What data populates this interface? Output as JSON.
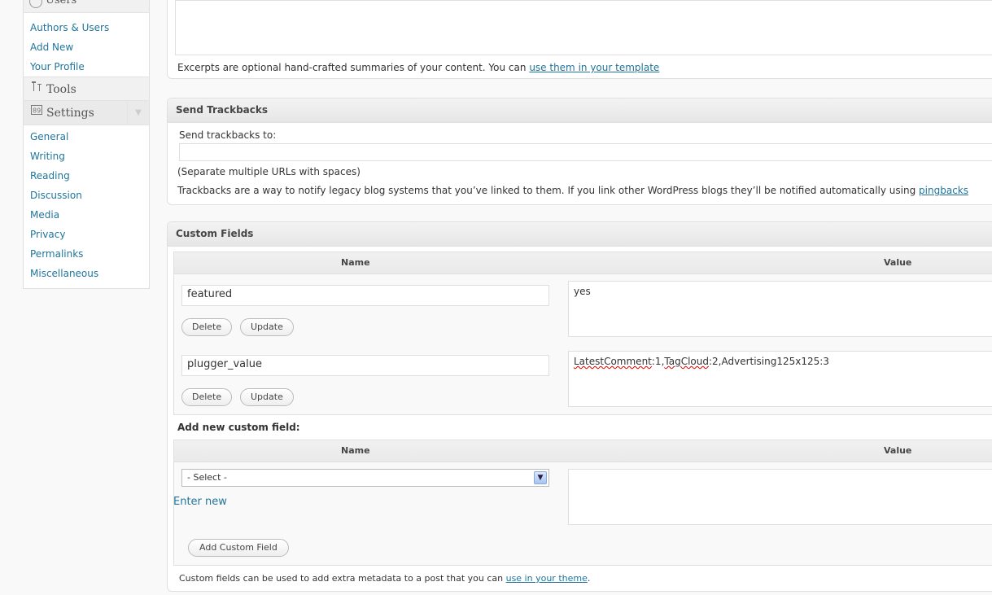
{
  "sidebar": {
    "top_stub_label": "Users",
    "users_items": [
      {
        "label": "Authors & Users"
      },
      {
        "label": "Add New"
      },
      {
        "label": "Your Profile"
      }
    ],
    "tools_label": "Tools",
    "settings_label": "Settings",
    "settings_items": [
      {
        "label": "General"
      },
      {
        "label": "Writing"
      },
      {
        "label": "Reading"
      },
      {
        "label": "Discussion"
      },
      {
        "label": "Media"
      },
      {
        "label": "Privacy"
      },
      {
        "label": "Permalinks"
      },
      {
        "label": "Miscellaneous"
      }
    ]
  },
  "excerpt": {
    "help_text": "Excerpts are optional hand-crafted summaries of your content. You can ",
    "help_link": "use them in your template"
  },
  "trackbacks": {
    "title": "Send Trackbacks",
    "label": "Send trackbacks to:",
    "hint": "(Separate multiple URLs with spaces)",
    "help_text": "Trackbacks are a way to notify legacy blog systems that you’ve linked to them. If you link other WordPress blogs they’ll be notified automatically using ",
    "help_link": "pingbacks"
  },
  "custom_fields": {
    "title": "Custom Fields",
    "col_name": "Name",
    "col_value": "Value",
    "rows": [
      {
        "name": "featured",
        "value": "yes",
        "delete_label": "Delete",
        "update_label": "Update"
      },
      {
        "name": "plugger_value",
        "value_parts": [
          "LatestComment",
          ":1,",
          "TagCloud",
          ":2,Advertising125x125:3"
        ],
        "delete_label": "Delete",
        "update_label": "Update"
      }
    ],
    "add_new_label": "Add new custom field:",
    "select_value": "- Select -",
    "enter_new_label": "Enter new",
    "add_button_label": "Add Custom Field",
    "help_text": "Custom fields can be used to add extra metadata to a post that you can ",
    "help_link": "use in your theme",
    "help_suffix": "."
  }
}
